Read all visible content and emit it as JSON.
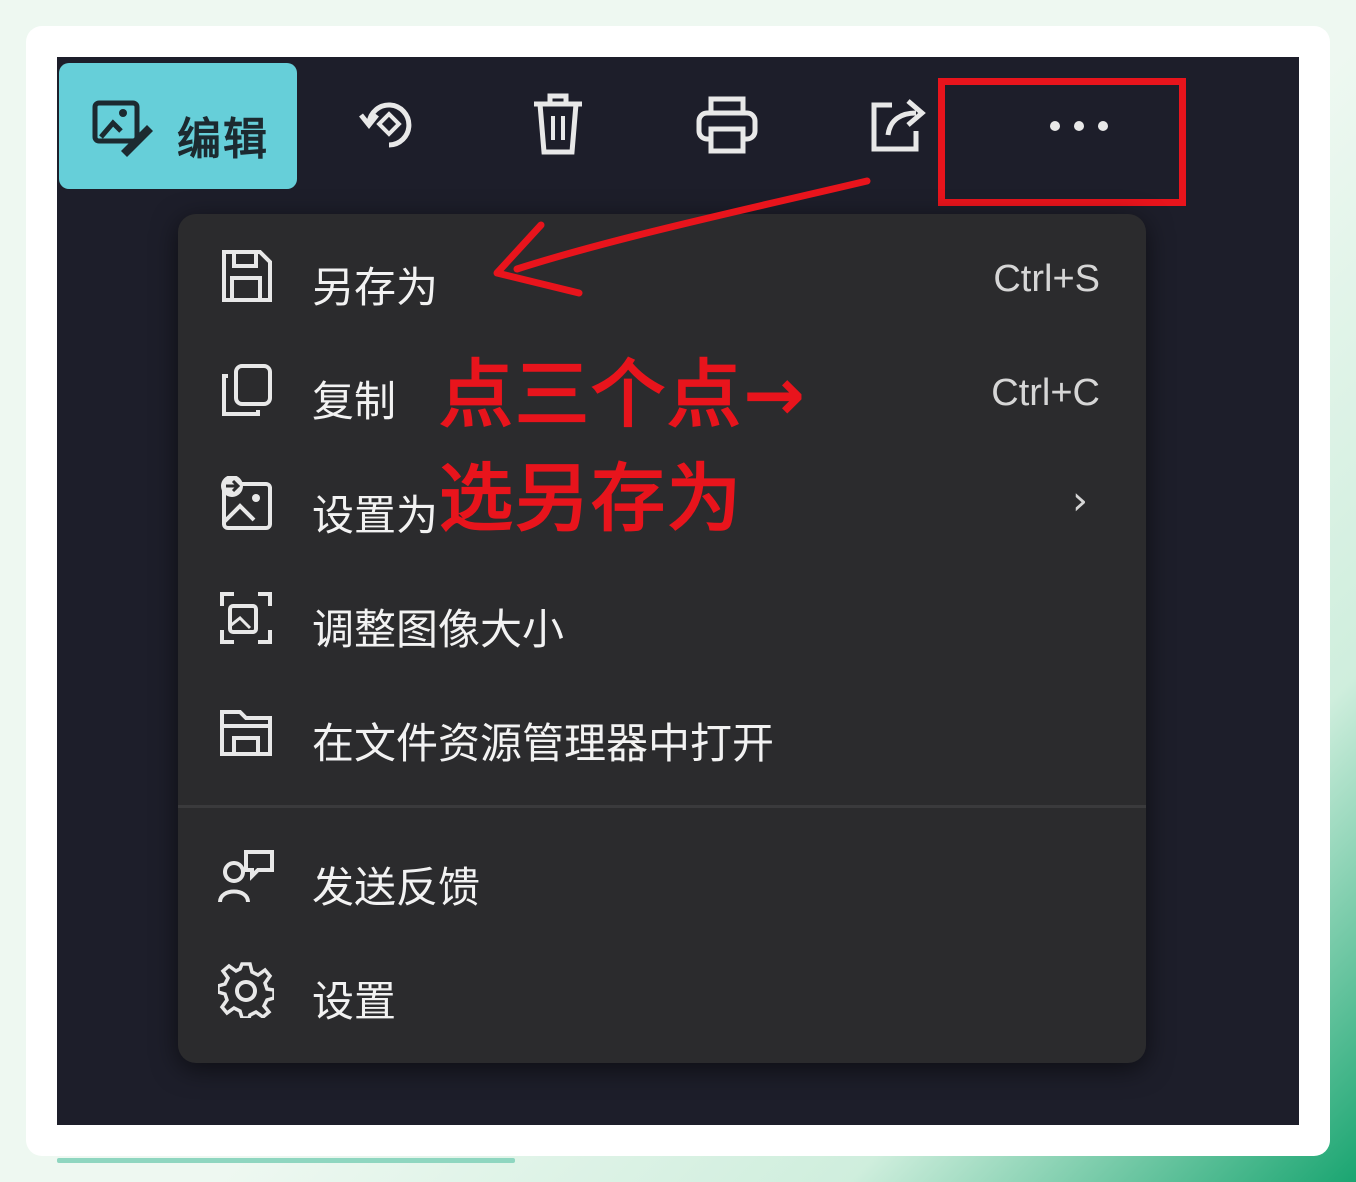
{
  "toolbar": {
    "edit_label": "编辑",
    "buttons": [
      "rotate-icon",
      "delete-icon",
      "print-icon",
      "share-icon",
      "more-icon"
    ]
  },
  "menu": {
    "items": [
      {
        "label": "另存为",
        "shortcut": "Ctrl+S",
        "icon": "save-icon"
      },
      {
        "label": "复制",
        "shortcut": "Ctrl+C",
        "icon": "copy-icon"
      },
      {
        "label": "设置为",
        "submenu": "›",
        "icon": "set-as-image-icon"
      },
      {
        "label": "调整图像大小",
        "icon": "resize-icon"
      },
      {
        "label": "在文件资源管理器中打开",
        "icon": "folder-icon"
      },
      {
        "label": "发送反馈",
        "icon": "feedback-icon"
      },
      {
        "label": "设置",
        "icon": "settings-gear-icon"
      }
    ]
  },
  "annotation": {
    "line1": "点三个点→",
    "line2": "选另存为",
    "color": "#e8141c"
  },
  "colors": {
    "accent": "#66cfd9",
    "background": "#1d1e2a",
    "menu": "#2b2b2d"
  }
}
